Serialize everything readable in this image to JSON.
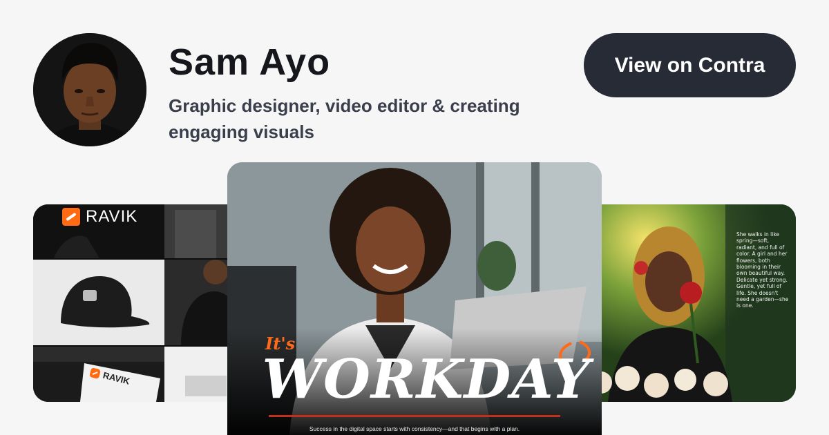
{
  "profile": {
    "name": "Sam Ayo",
    "tagline": "Graphic designer, video editor & creating engaging visuals",
    "avatar_alt": "Sam Ayo"
  },
  "header": {
    "cta_label": "View on Contra"
  },
  "portfolio": {
    "left": {
      "brand": "RAVIK"
    },
    "center": {
      "headline_small": "It's",
      "headline_big": "WORKDAY",
      "caption": "Success in the digital space starts with consistency—and that begins with a plan."
    },
    "right": {
      "poem": "She walks in like spring—soft, radiant, and full of color. A girl and her flowers, both blooming in their own beautiful way. Delicate yet strong. Gentle, yet full of life. She doesn't need a garden—she is one."
    }
  },
  "colors": {
    "background": "#f6f6f6",
    "button": "#262b35",
    "brand_accent": "#ff6a13"
  }
}
